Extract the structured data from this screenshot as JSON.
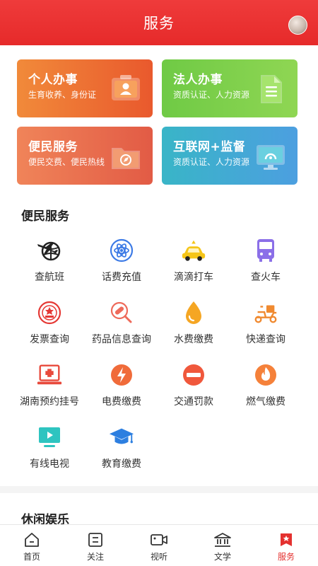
{
  "header": {
    "title": "服务"
  },
  "cards": [
    {
      "title": "个人办事",
      "subtitle": "生育收养、身份证",
      "icon": "id-card-icon"
    },
    {
      "title": "法人办事",
      "subtitle": "资质认证、人力资源",
      "icon": "document-icon"
    },
    {
      "title": "便民服务",
      "subtitle": "便民交费、便民热线",
      "icon": "folder-compass-icon"
    },
    {
      "title": "互联网+监督",
      "subtitle": "资质认证、人力资源",
      "icon": "monitor-icon"
    }
  ],
  "services": {
    "title": "便民服务",
    "items": [
      {
        "label": "查航班",
        "icon": "plane-globe-icon"
      },
      {
        "label": "话费充值",
        "icon": "atom-icon"
      },
      {
        "label": "滴滴打车",
        "icon": "car-icon"
      },
      {
        "label": "查火车",
        "icon": "bus-icon"
      },
      {
        "label": "发票查询",
        "icon": "tax-seal-icon"
      },
      {
        "label": "药品信息查询",
        "icon": "pill-icon"
      },
      {
        "label": "水费缴费",
        "icon": "water-drop-icon"
      },
      {
        "label": "快递查询",
        "icon": "delivery-scooter-icon"
      },
      {
        "label": "湖南预约挂号",
        "icon": "medical-laptop-icon"
      },
      {
        "label": "电费缴费",
        "icon": "lightning-icon"
      },
      {
        "label": "交通罚款",
        "icon": "no-entry-icon"
      },
      {
        "label": "燃气缴费",
        "icon": "flame-icon"
      },
      {
        "label": "有线电视",
        "icon": "tv-play-icon"
      },
      {
        "label": "教育缴费",
        "icon": "graduation-cap-icon"
      }
    ]
  },
  "leisure": {
    "title": "休闲娱乐"
  },
  "tabbar": {
    "items": [
      {
        "label": "首页",
        "icon": "home-icon",
        "active": false
      },
      {
        "label": "关注",
        "icon": "follow-icon",
        "active": false
      },
      {
        "label": "视听",
        "icon": "video-icon",
        "active": false
      },
      {
        "label": "文学",
        "icon": "library-icon",
        "active": false
      },
      {
        "label": "服务",
        "icon": "service-badge-icon",
        "active": true
      }
    ]
  },
  "colors": {
    "brand_red": "#e62a2a",
    "active_tab": "#e4312f"
  }
}
